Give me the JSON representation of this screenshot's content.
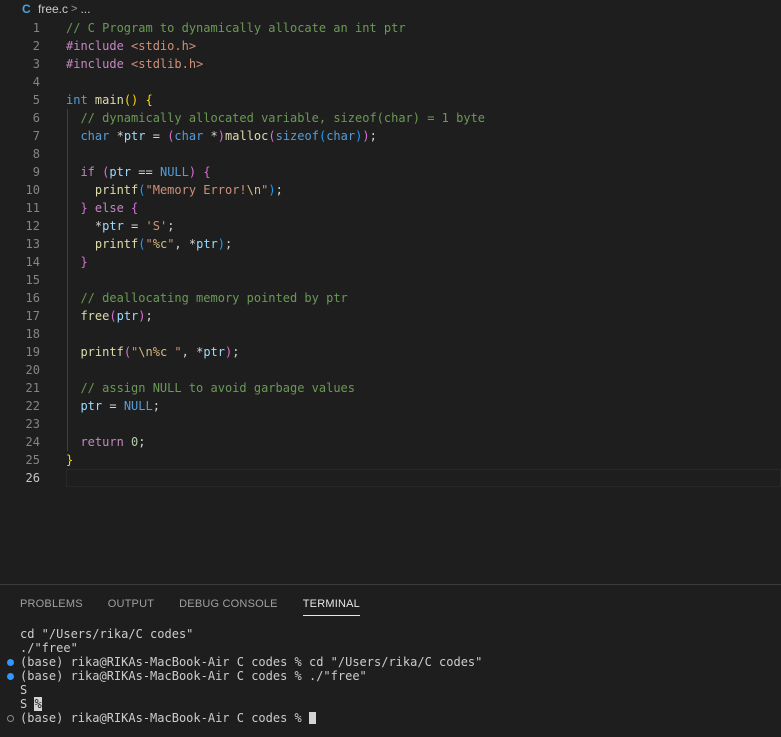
{
  "breadcrumb": {
    "file_icon": "C",
    "file_name": "free.c",
    "separator": ">",
    "more": "..."
  },
  "editor": {
    "line_numbers": [
      "1",
      "2",
      "3",
      "4",
      "5",
      "6",
      "7",
      "8",
      "9",
      "10",
      "11",
      "12",
      "13",
      "14",
      "15",
      "16",
      "17",
      "18",
      "19",
      "20",
      "21",
      "22",
      "23",
      "24",
      "25",
      "26"
    ],
    "active_line": "26",
    "lines": [
      [
        [
          "c",
          "// C Program to dynamically allocate an int ptr"
        ]
      ],
      [
        [
          "pp",
          "#include "
        ],
        [
          "inc",
          "<stdio.h>"
        ]
      ],
      [
        [
          "pp",
          "#include "
        ],
        [
          "inc",
          "<stdlib.h>"
        ]
      ],
      [],
      [
        [
          "kw",
          "int "
        ],
        [
          "fn",
          "main"
        ],
        [
          "br1",
          "() {"
        ]
      ],
      [
        [
          "op",
          "  "
        ],
        [
          "c",
          "// dynamically allocated variable, sizeof(char) = 1 byte"
        ]
      ],
      [
        [
          "op",
          "  "
        ],
        [
          "kw",
          "char "
        ],
        [
          "op",
          "*"
        ],
        [
          "var",
          "ptr"
        ],
        [
          "op",
          " = "
        ],
        [
          "br2",
          "("
        ],
        [
          "kw",
          "char "
        ],
        [
          "op",
          "*"
        ],
        [
          "br2",
          ")"
        ],
        [
          "fn",
          "malloc"
        ],
        [
          "br2",
          "("
        ],
        [
          "kw",
          "sizeof"
        ],
        [
          "br3",
          "("
        ],
        [
          "kw",
          "char"
        ],
        [
          "br3",
          ")"
        ],
        [
          "br2",
          ")"
        ],
        [
          "op",
          ";"
        ]
      ],
      [],
      [
        [
          "op",
          "  "
        ],
        [
          "ctl",
          "if "
        ],
        [
          "br2",
          "("
        ],
        [
          "var",
          "ptr"
        ],
        [
          "op",
          " == "
        ],
        [
          "kw",
          "NULL"
        ],
        [
          "br2",
          ") {"
        ]
      ],
      [
        [
          "op",
          "    "
        ],
        [
          "fn",
          "printf"
        ],
        [
          "br3",
          "("
        ],
        [
          "str",
          "\"Memory Error!"
        ],
        [
          "esc",
          "\\n"
        ],
        [
          "str",
          "\""
        ],
        [
          "br3",
          ")"
        ],
        [
          "op",
          ";"
        ]
      ],
      [
        [
          "op",
          "  "
        ],
        [
          "br2",
          "} "
        ],
        [
          "ctl",
          "else "
        ],
        [
          "br2",
          "{"
        ]
      ],
      [
        [
          "op",
          "    *"
        ],
        [
          "var",
          "ptr"
        ],
        [
          "op",
          " = "
        ],
        [
          "str",
          "'S'"
        ],
        [
          "op",
          ";"
        ]
      ],
      [
        [
          "op",
          "    "
        ],
        [
          "fn",
          "printf"
        ],
        [
          "br3",
          "("
        ],
        [
          "str",
          "\""
        ],
        [
          "esc",
          "%c"
        ],
        [
          "str",
          "\""
        ],
        [
          "op",
          ", *"
        ],
        [
          "var",
          "ptr"
        ],
        [
          "br3",
          ")"
        ],
        [
          "op",
          ";"
        ]
      ],
      [
        [
          "op",
          "  "
        ],
        [
          "br2",
          "}"
        ]
      ],
      [],
      [
        [
          "op",
          "  "
        ],
        [
          "c",
          "// deallocating memory pointed by ptr"
        ]
      ],
      [
        [
          "op",
          "  "
        ],
        [
          "fn",
          "free"
        ],
        [
          "br2",
          "("
        ],
        [
          "var",
          "ptr"
        ],
        [
          "br2",
          ")"
        ],
        [
          "op",
          ";"
        ]
      ],
      [],
      [
        [
          "op",
          "  "
        ],
        [
          "fn",
          "printf"
        ],
        [
          "br2",
          "("
        ],
        [
          "str",
          "\""
        ],
        [
          "esc",
          "\\n%c"
        ],
        [
          "str",
          " \""
        ],
        [
          "op",
          ", *"
        ],
        [
          "var",
          "ptr"
        ],
        [
          "br2",
          ")"
        ],
        [
          "op",
          ";"
        ]
      ],
      [],
      [
        [
          "op",
          "  "
        ],
        [
          "c",
          "// assign NULL to avoid garbage values"
        ]
      ],
      [
        [
          "op",
          "  "
        ],
        [
          "var",
          "ptr"
        ],
        [
          "op",
          " = "
        ],
        [
          "kw",
          "NULL"
        ],
        [
          "op",
          ";"
        ]
      ],
      [],
      [
        [
          "op",
          "  "
        ],
        [
          "ctl",
          "return "
        ],
        [
          "num",
          "0"
        ],
        [
          "op",
          ";"
        ]
      ],
      [
        [
          "br1",
          "}"
        ]
      ],
      []
    ]
  },
  "panel": {
    "tabs": [
      {
        "label": "PROBLEMS",
        "active": false
      },
      {
        "label": "OUTPUT",
        "active": false
      },
      {
        "label": "DEBUG CONSOLE",
        "active": false
      },
      {
        "label": "TERMINAL",
        "active": true
      }
    ]
  },
  "terminal": {
    "lines": [
      {
        "marker": "none",
        "text": "cd \"/Users/rika/C codes\""
      },
      {
        "marker": "none",
        "text": "./\"free\""
      },
      {
        "marker": "blue",
        "text": "(base) rika@RIKAs-MacBook-Air C codes % cd \"/Users/rika/C codes\""
      },
      {
        "marker": "blue",
        "text": "(base) rika@RIKAs-MacBook-Air C codes % ./\"free\""
      },
      {
        "marker": "none",
        "text": "S"
      },
      {
        "marker": "none",
        "text": "S ",
        "highlight": "%"
      },
      {
        "marker": "hollow",
        "text": "(base) rika@RIKAs-MacBook-Air C codes % ",
        "cursor": true
      }
    ]
  }
}
